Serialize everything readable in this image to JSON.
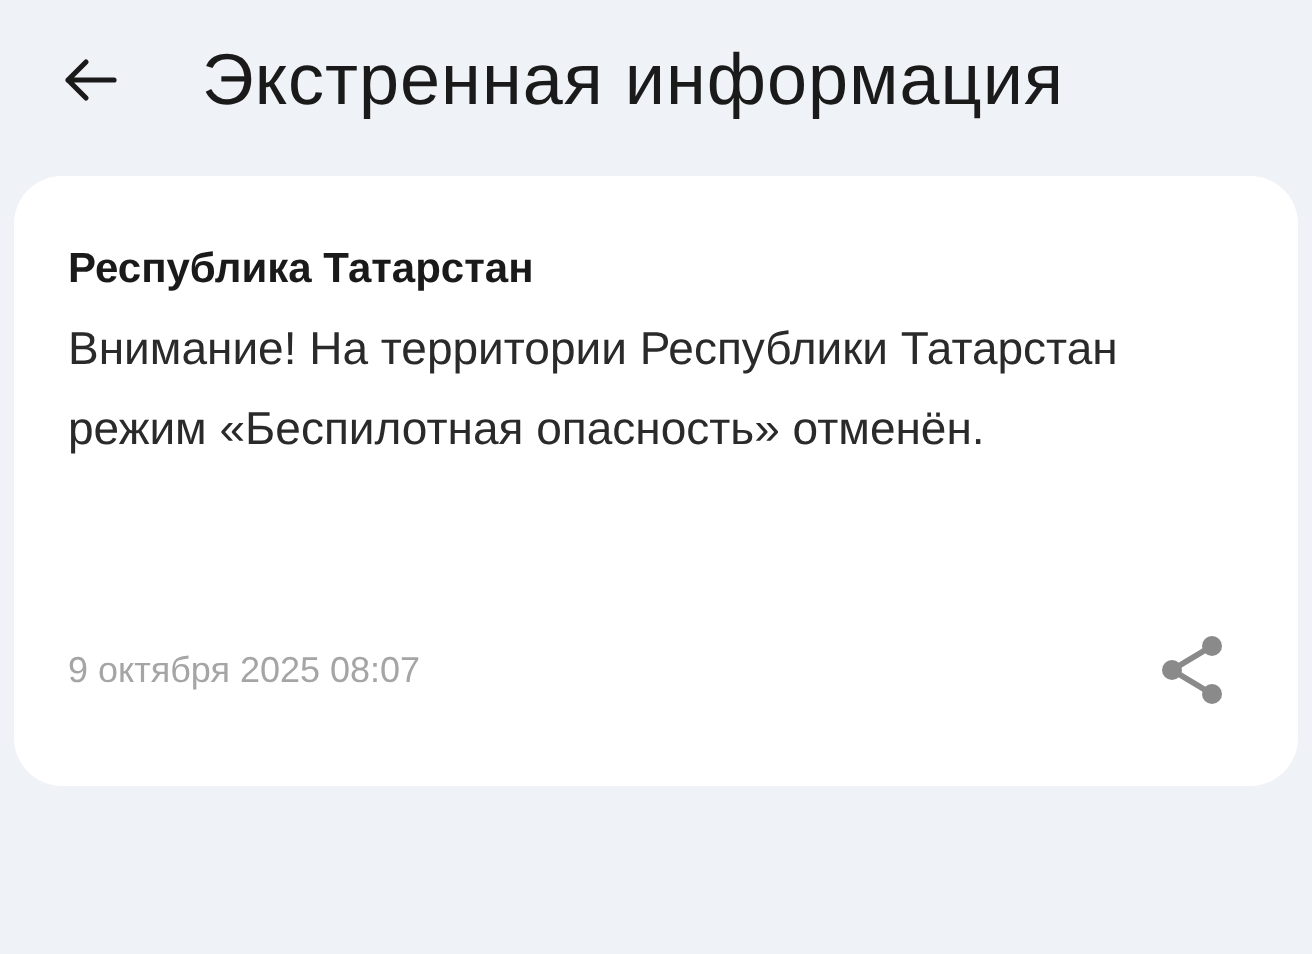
{
  "header": {
    "title": "Экстренная информация"
  },
  "alert": {
    "region": "Республика Татарстан",
    "message": "Внимание! На территории Республики Татарстан режим «Беспилотная опасность» отменён.",
    "timestamp": "9 октября 2025 08:07"
  }
}
